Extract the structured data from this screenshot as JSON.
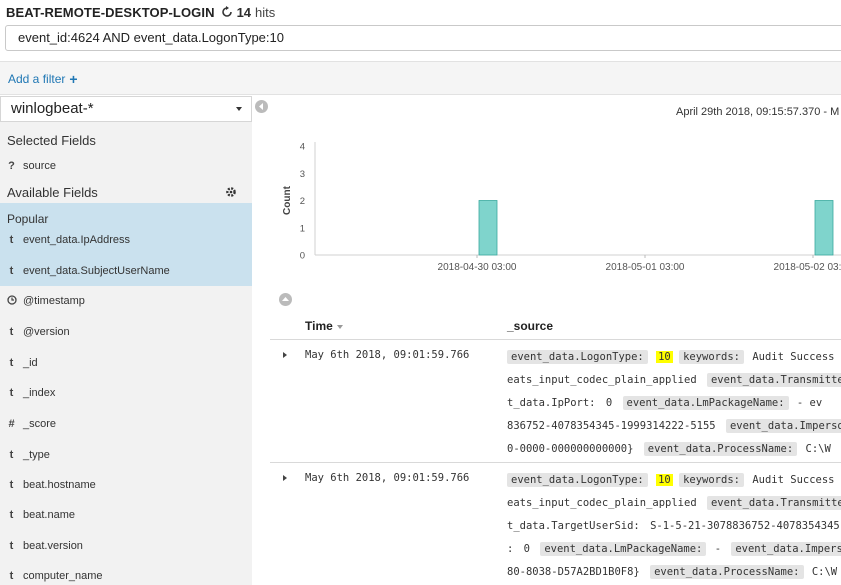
{
  "header": {
    "title": "BEAT-REMOTE-DESKTOP-LOGIN",
    "hits_count": "14",
    "hits_label": "hits"
  },
  "query": {
    "value": "event_id:4624 AND event_data.LogonType:10"
  },
  "filter": {
    "add_label": "Add a filter"
  },
  "sidebar": {
    "index_pattern": "winlogbeat-*",
    "selected_title": "Selected Fields",
    "selected_fields": [
      {
        "type": "?",
        "name": "source"
      }
    ],
    "available_title": "Available Fields",
    "popular_label": "Popular",
    "popular_fields": [
      {
        "type": "t",
        "name": "event_data.IpAddress"
      },
      {
        "type": "t",
        "name": "event_data.SubjectUserName"
      }
    ],
    "fields": [
      {
        "type": "clock",
        "name": "@timestamp"
      },
      {
        "type": "t",
        "name": "@version"
      },
      {
        "type": "t",
        "name": "_id"
      },
      {
        "type": "t",
        "name": "_index"
      },
      {
        "type": "#",
        "name": "_score"
      },
      {
        "type": "t",
        "name": "_type"
      },
      {
        "type": "t",
        "name": "beat.hostname"
      },
      {
        "type": "t",
        "name": "beat.name"
      },
      {
        "type": "t",
        "name": "beat.version"
      },
      {
        "type": "t",
        "name": "computer_name"
      }
    ]
  },
  "time_range": "April 29th 2018, 09:15:57.370 - M",
  "chart_data": {
    "type": "bar",
    "ylabel": "Count",
    "yticks": [
      0,
      1,
      2,
      3,
      4
    ],
    "ylim": [
      0,
      4
    ],
    "x_ticks": [
      "2018-04-30 03:00",
      "2018-05-01 03:00",
      "2018-05-02 03:00"
    ],
    "bars": [
      {
        "x": "2018-04-30 03:00",
        "value": 2
      },
      {
        "x": "2018-05-02 03:00",
        "value": 2
      }
    ],
    "bar_color": "#7fd4cc"
  },
  "table": {
    "col_time": "Time",
    "col_source": "_source",
    "rows": [
      {
        "time": "May 6th 2018, 09:01:59.766",
        "lines": [
          [
            {
              "k": "event_data.LogonType:"
            },
            {
              "h": "10"
            },
            {
              "k": "keywords:"
            },
            {
              "v": "Audit Success"
            }
          ],
          [
            {
              "v": "eats_input_codec_plain_applied"
            },
            {
              "k": "event_data.TransmittedServices:"
            }
          ],
          [
            {
              "v": "t_data.IpPort:"
            },
            {
              "v": "0"
            },
            {
              "k": "event_data.LmPackageName:"
            },
            {
              "v": "- ev"
            }
          ],
          [
            {
              "v": "836752-4078354345-1999314222-5155"
            },
            {
              "k": "event_data.ImpersonationLevel:"
            }
          ],
          [
            {
              "v": "0-0000-000000000000}"
            },
            {
              "k": "event_data.ProcessName:"
            },
            {
              "v": "C:\\W"
            }
          ]
        ]
      },
      {
        "time": "May 6th 2018, 09:01:59.766",
        "lines": [
          [
            {
              "k": "event_data.LogonType:"
            },
            {
              "h": "10"
            },
            {
              "k": "keywords:"
            },
            {
              "v": "Audit Success"
            }
          ],
          [
            {
              "v": "eats_input_codec_plain_applied"
            },
            {
              "k": "event_data.TransmittedServices:"
            }
          ],
          [
            {
              "v": "t_data.TargetUserSid:"
            },
            {
              "v": "S-1-5-21-3078836752-4078354345"
            }
          ],
          [
            {
              "v": ":"
            },
            {
              "v": "0"
            },
            {
              "k": "event_data.LmPackageName:"
            },
            {
              "v": "-"
            },
            {
              "k": "event_data.ImpersonationLevel:"
            }
          ],
          [
            {
              "v": "80-8038-D57A2BD1B0F8}"
            },
            {
              "k": "event_data.ProcessName:"
            },
            {
              "v": "C:\\W"
            }
          ]
        ]
      }
    ]
  }
}
